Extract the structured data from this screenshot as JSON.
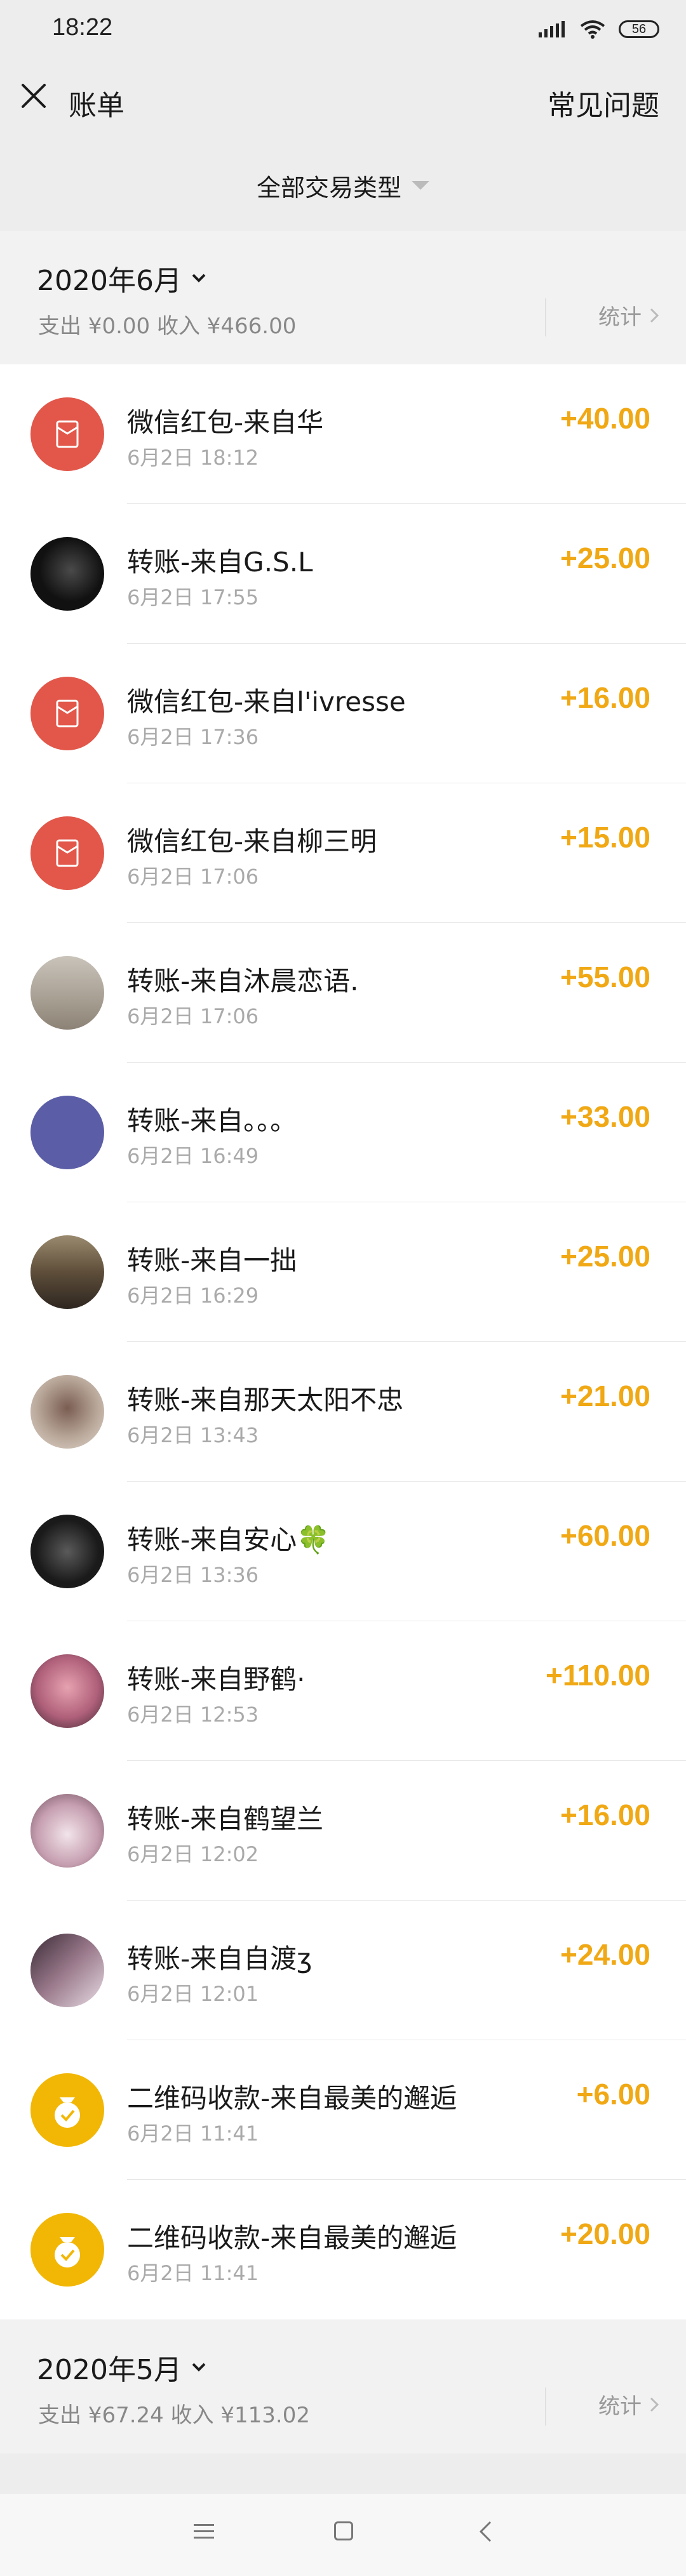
{
  "status_bar": {
    "time": "18:22",
    "battery": "56"
  },
  "nav": {
    "title": "账单",
    "faq": "常见问题"
  },
  "filter": {
    "label": "全部交易类型"
  },
  "months": [
    {
      "month": "2020年6月",
      "summary": "支出 ¥0.00 收入 ¥466.00",
      "stats": "统计"
    },
    {
      "month": "2020年5月",
      "summary": "支出 ¥67.24 收入 ¥113.02",
      "stats": "统计"
    }
  ],
  "transactions": [
    {
      "title": "微信红包-来自华",
      "time": "6月2日 18:12",
      "amount": "+40.00",
      "icon": "red-packet-icon",
      "color": "#e2574a"
    },
    {
      "title": "转账-来自G.S.L",
      "time": "6月2日 17:55",
      "amount": "+25.00",
      "icon": "avatar",
      "color": "#141414"
    },
    {
      "title": "微信红包-来自l'ivresse",
      "time": "6月2日 17:36",
      "amount": "+16.00",
      "icon": "red-packet-icon",
      "color": "#e2574a"
    },
    {
      "title": "微信红包-来自柳三明",
      "time": "6月2日 17:06",
      "amount": "+15.00",
      "icon": "red-packet-icon",
      "color": "#e2574a"
    },
    {
      "title": "转账-来自沐晨恋语.",
      "time": "6月2日 17:06",
      "amount": "+55.00",
      "icon": "avatar",
      "color": "#b8b0a4"
    },
    {
      "title": "转账-来自。。。",
      "time": "6月2日 16:49",
      "amount": "+33.00",
      "icon": "avatar",
      "color": "#5b5ea6"
    },
    {
      "title": "转账-来自一拙",
      "time": "6月2日 16:29",
      "amount": "+25.00",
      "icon": "avatar",
      "color": "#6b5a44"
    },
    {
      "title": "转账-来自那天太阳不忠",
      "time": "6月2日 13:43",
      "amount": "+21.00",
      "icon": "avatar",
      "color": "#a08a7a"
    },
    {
      "title": "转账-来自安心🍀",
      "time": "6月2日 13:36",
      "amount": "+60.00",
      "icon": "avatar",
      "color": "#1e1e1e"
    },
    {
      "title": "转账-来自野鹤·",
      "time": "6月2日 12:53",
      "amount": "+110.00",
      "icon": "avatar",
      "color": "#c67b8a"
    },
    {
      "title": "转账-来自鹤望兰",
      "time": "6月2日 12:02",
      "amount": "+16.00",
      "icon": "avatar",
      "color": "#c9aeb8"
    },
    {
      "title": "转账-来自自渡ʒ",
      "time": "6月2日 12:01",
      "amount": "+24.00",
      "icon": "avatar",
      "color": "#8a6e7e"
    },
    {
      "title": "二维码收款-来自最美的邂逅",
      "time": "6月2日 11:41",
      "amount": "+6.00",
      "icon": "money-bag-icon",
      "color": "#f2b705"
    },
    {
      "title": "二维码收款-来自最美的邂逅",
      "time": "6月2日 11:41",
      "amount": "+20.00",
      "icon": "money-bag-icon",
      "color": "#f2b705"
    }
  ]
}
